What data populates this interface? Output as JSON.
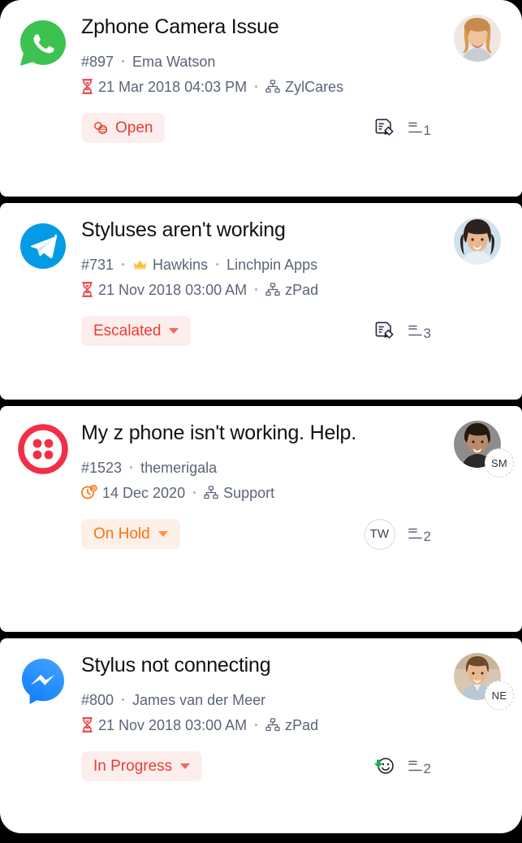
{
  "background_color": "#000000",
  "card_background": "#ffffff",
  "colors": {
    "title": "#111111",
    "meta": "#5b6478",
    "open_text": "#ea3d2f",
    "open_bg": "#fdeeee",
    "escalated_text": "#ea3d2f",
    "escalated_bg": "#fdeeee",
    "onhold_text": "#f97316",
    "onhold_bg": "#fdf0e7",
    "inprogress_text": "#ea3d2f",
    "inprogress_bg": "#fdeeee",
    "whatsapp": "#3dc14f",
    "telegram": "#039be5",
    "twilio": "#f22f46",
    "messenger": "#0a7cff",
    "crown": "#f5c33b",
    "hourglass": "#e4474b",
    "clock_hold": "#f97316"
  },
  "tickets": [
    {
      "channel": "whatsapp-icon",
      "title": "Zphone Camera Issue",
      "number": "#897",
      "vip": false,
      "requester": "Ema Watson",
      "account": "",
      "due_icon": "hourglass-icon",
      "due": "21 Mar 2018 04:03 PM",
      "department_icon": "sitemap-icon",
      "department": "ZylCares",
      "status": {
        "label": "Open",
        "has_caret": false,
        "icon": "status-circles-icon",
        "style": "open"
      },
      "agent_initials": "",
      "avatar_badge": "",
      "actions": [
        "note-edit-icon"
      ],
      "thread_count": "1",
      "avatar": "avatar-woman-blonde"
    },
    {
      "channel": "telegram-icon",
      "title": "Styluses aren't working",
      "number": "#731",
      "vip": true,
      "requester": "Hawkins",
      "account": "Linchpin Apps",
      "due_icon": "hourglass-icon",
      "due": "21 Nov 2018 03:00 AM",
      "department_icon": "sitemap-icon",
      "department": "zPad",
      "status": {
        "label": "Escalated",
        "has_caret": true,
        "icon": "",
        "style": "escalated"
      },
      "agent_initials": "",
      "avatar_badge": "",
      "actions": [
        "note-edit-icon"
      ],
      "thread_count": "3",
      "avatar": "avatar-woman-asian"
    },
    {
      "channel": "twilio-icon",
      "title": "My z phone isn't working. Help.",
      "number": "#1523",
      "vip": false,
      "requester": "themerigala",
      "account": "",
      "due_icon": "clock-hold-icon",
      "due": "14 Dec 2020",
      "department_icon": "sitemap-icon",
      "department": "Support",
      "status": {
        "label": "On Hold",
        "has_caret": true,
        "icon": "",
        "style": "onhold"
      },
      "agent_initials": "TW",
      "avatar_badge": "SM",
      "actions": [],
      "thread_count": "2",
      "avatar": "avatar-woman-dark"
    },
    {
      "channel": "messenger-icon",
      "title": "Stylus not connecting",
      "number": "#800",
      "vip": false,
      "requester": "James van der Meer",
      "account": "",
      "due_icon": "hourglass-icon",
      "due": "21 Nov 2018 03:00 AM",
      "department_icon": "sitemap-icon",
      "department": "zPad",
      "status": {
        "label": "In Progress",
        "has_caret": true,
        "icon": "",
        "style": "inprogress"
      },
      "agent_initials": "",
      "avatar_badge": "NE",
      "actions": [
        "happy-smiley-icon"
      ],
      "thread_count": "2",
      "avatar": "avatar-man-brown"
    }
  ]
}
